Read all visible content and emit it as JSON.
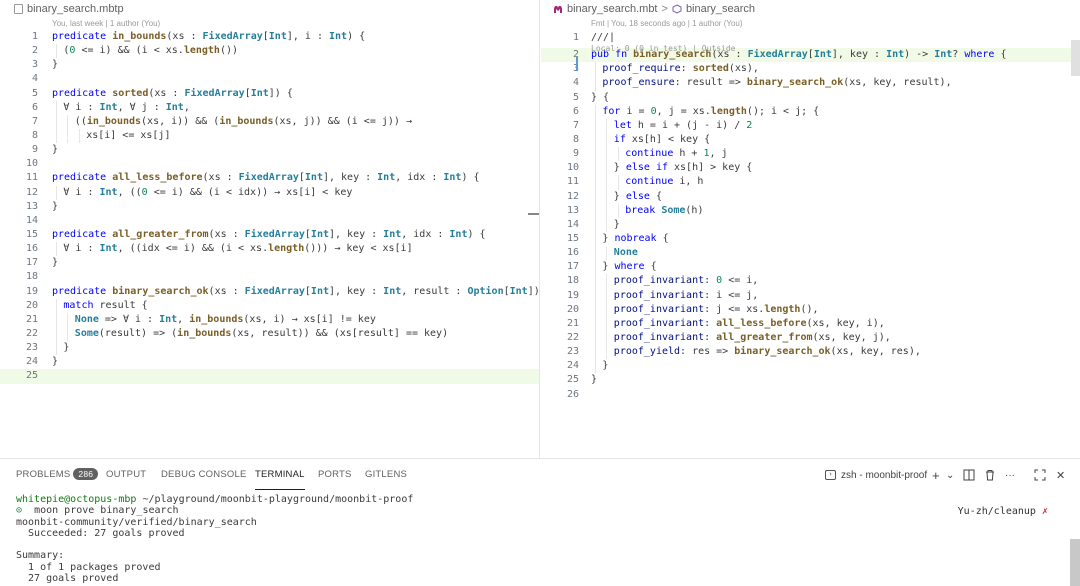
{
  "left_editor": {
    "breadcrumb": "binary_search.mbtp",
    "blame": "You, last week | 1 author (You)",
    "lines": [
      {
        "n": "1",
        "ind": 0,
        "segs": [
          [
            "kw",
            "predicate "
          ],
          [
            "fn",
            "in_bounds"
          ],
          [
            "t",
            "(xs : "
          ],
          [
            "ty",
            "FixedArray"
          ],
          [
            "t",
            "["
          ],
          [
            "ty",
            "Int"
          ],
          [
            "t",
            "], i : "
          ],
          [
            "ty",
            "Int"
          ],
          [
            "t",
            ") {"
          ]
        ]
      },
      {
        "n": "2",
        "ind": 1,
        "segs": [
          [
            "t",
            "("
          ],
          [
            "num",
            "0"
          ],
          [
            "t",
            " <= i) && (i < xs."
          ],
          [
            "fn",
            "length"
          ],
          [
            "t",
            "())"
          ]
        ]
      },
      {
        "n": "3",
        "ind": 0,
        "segs": [
          [
            "t",
            "}"
          ]
        ]
      },
      {
        "n": "4",
        "ind": 0,
        "segs": []
      },
      {
        "n": "5",
        "ind": 0,
        "segs": [
          [
            "kw",
            "predicate "
          ],
          [
            "fn",
            "sorted"
          ],
          [
            "t",
            "(xs : "
          ],
          [
            "ty",
            "FixedArray"
          ],
          [
            "t",
            "["
          ],
          [
            "ty",
            "Int"
          ],
          [
            "t",
            "]) {"
          ]
        ]
      },
      {
        "n": "6",
        "ind": 1,
        "segs": [
          [
            "t",
            "∀ i : "
          ],
          [
            "ty",
            "Int"
          ],
          [
            "t",
            ", ∀ j : "
          ],
          [
            "ty",
            "Int"
          ],
          [
            "t",
            ","
          ]
        ]
      },
      {
        "n": "7",
        "ind": 2,
        "segs": [
          [
            "t",
            "(("
          ],
          [
            "fn",
            "in_bounds"
          ],
          [
            "t",
            "(xs, i)) && ("
          ],
          [
            "fn",
            "in_bounds"
          ],
          [
            "t",
            "(xs, j)) && (i <= j)) →"
          ]
        ]
      },
      {
        "n": "8",
        "ind": 3,
        "segs": [
          [
            "t",
            "xs[i] <= xs[j]"
          ]
        ]
      },
      {
        "n": "9",
        "ind": 0,
        "segs": [
          [
            "t",
            "}"
          ]
        ]
      },
      {
        "n": "10",
        "ind": 0,
        "segs": []
      },
      {
        "n": "11",
        "ind": 0,
        "segs": [
          [
            "kw",
            "predicate "
          ],
          [
            "fn",
            "all_less_before"
          ],
          [
            "t",
            "(xs : "
          ],
          [
            "ty",
            "FixedArray"
          ],
          [
            "t",
            "["
          ],
          [
            "ty",
            "Int"
          ],
          [
            "t",
            "], key : "
          ],
          [
            "ty",
            "Int"
          ],
          [
            "t",
            ", idx : "
          ],
          [
            "ty",
            "Int"
          ],
          [
            "t",
            ") {"
          ]
        ]
      },
      {
        "n": "12",
        "ind": 1,
        "segs": [
          [
            "t",
            "∀ i : "
          ],
          [
            "ty",
            "Int"
          ],
          [
            "t",
            ", (("
          ],
          [
            "num",
            "0"
          ],
          [
            "t",
            " <= i) && (i < idx)) → xs[i] < key"
          ]
        ]
      },
      {
        "n": "13",
        "ind": 0,
        "segs": [
          [
            "t",
            "}"
          ]
        ]
      },
      {
        "n": "14",
        "ind": 0,
        "segs": []
      },
      {
        "n": "15",
        "ind": 0,
        "segs": [
          [
            "kw",
            "predicate "
          ],
          [
            "fn",
            "all_greater_from"
          ],
          [
            "t",
            "(xs : "
          ],
          [
            "ty",
            "FixedArray"
          ],
          [
            "t",
            "["
          ],
          [
            "ty",
            "Int"
          ],
          [
            "t",
            "], key : "
          ],
          [
            "ty",
            "Int"
          ],
          [
            "t",
            ", idx : "
          ],
          [
            "ty",
            "Int"
          ],
          [
            "t",
            ") {"
          ]
        ]
      },
      {
        "n": "16",
        "ind": 1,
        "segs": [
          [
            "t",
            "∀ i : "
          ],
          [
            "ty",
            "Int"
          ],
          [
            "t",
            ", ((idx <= i) && (i < xs."
          ],
          [
            "fn",
            "length"
          ],
          [
            "t",
            "())) → key < xs[i]"
          ]
        ]
      },
      {
        "n": "17",
        "ind": 0,
        "segs": [
          [
            "t",
            "}"
          ]
        ]
      },
      {
        "n": "18",
        "ind": 0,
        "segs": []
      },
      {
        "n": "19",
        "ind": 0,
        "segs": [
          [
            "kw",
            "predicate "
          ],
          [
            "fn",
            "binary_search_ok"
          ],
          [
            "t",
            "(xs : "
          ],
          [
            "ty",
            "FixedArray"
          ],
          [
            "t",
            "["
          ],
          [
            "ty",
            "Int"
          ],
          [
            "t",
            "], key : "
          ],
          [
            "ty",
            "Int"
          ],
          [
            "t",
            ", result : "
          ],
          [
            "ty",
            "Option"
          ],
          [
            "t",
            "["
          ],
          [
            "ty",
            "Int"
          ],
          [
            "t",
            "]) {"
          ]
        ]
      },
      {
        "n": "20",
        "ind": 1,
        "segs": [
          [
            "kw",
            "match "
          ],
          [
            "t",
            "result {"
          ]
        ]
      },
      {
        "n": "21",
        "ind": 2,
        "segs": [
          [
            "ty",
            "None"
          ],
          [
            "t",
            " => ∀ i : "
          ],
          [
            "ty",
            "Int"
          ],
          [
            "t",
            ", "
          ],
          [
            "fn",
            "in_bounds"
          ],
          [
            "t",
            "(xs, i) → xs[i] != key"
          ]
        ]
      },
      {
        "n": "22",
        "ind": 2,
        "segs": [
          [
            "ty",
            "Some"
          ],
          [
            "t",
            "(result) => ("
          ],
          [
            "fn",
            "in_bounds"
          ],
          [
            "t",
            "(xs, result)) && (xs[result] == key)"
          ]
        ]
      },
      {
        "n": "23",
        "ind": 1,
        "segs": [
          [
            "t",
            "}"
          ]
        ]
      },
      {
        "n": "24",
        "ind": 0,
        "segs": [
          [
            "t",
            "}"
          ]
        ]
      },
      {
        "n": "25",
        "ind": 0,
        "segs": [],
        "hl": true
      }
    ]
  },
  "right_editor": {
    "breadcrumb_file": "binary_search.mbt",
    "breadcrumb_sep": ">",
    "breadcrumb_symbol": "binary_search",
    "codelens": "Fmt | You, 18 seconds ago | 1 author (You)",
    "blame_inline": "Local: 0 (0 in test) | Outside",
    "lines": [
      {
        "n": "1",
        "ind": 0,
        "segs": [
          [
            "t",
            "///|"
          ]
        ]
      },
      {
        "n": "2",
        "ind": 0,
        "segs": [
          [
            "kw",
            "pub fn "
          ],
          [
            "fn",
            "binary_search"
          ],
          [
            "t",
            "(xs : "
          ],
          [
            "ty",
            "FixedArray"
          ],
          [
            "t",
            "["
          ],
          [
            "ty",
            "Int"
          ],
          [
            "t",
            "], key : "
          ],
          [
            "ty",
            "Int"
          ],
          [
            "t",
            ") -> "
          ],
          [
            "ty",
            "Int"
          ],
          [
            "t",
            "? "
          ],
          [
            "kw",
            "where"
          ],
          [
            "t",
            " {"
          ]
        ],
        "hl": true
      },
      {
        "n": "3",
        "ind": 1,
        "segs": [
          [
            "pr",
            "proof_require"
          ],
          [
            "t",
            ": "
          ],
          [
            "fn",
            "sorted"
          ],
          [
            "t",
            "(xs),"
          ]
        ]
      },
      {
        "n": "4",
        "ind": 1,
        "segs": [
          [
            "pr",
            "proof_ensure"
          ],
          [
            "t",
            ": result => "
          ],
          [
            "fn",
            "binary_search_ok"
          ],
          [
            "t",
            "(xs, key, result),"
          ]
        ]
      },
      {
        "n": "5",
        "ind": 0,
        "segs": [
          [
            "t",
            "} {"
          ]
        ]
      },
      {
        "n": "6",
        "ind": 1,
        "segs": [
          [
            "kw",
            "for "
          ],
          [
            "t",
            "i = "
          ],
          [
            "num",
            "0"
          ],
          [
            "t",
            ", j = xs."
          ],
          [
            "fn",
            "length"
          ],
          [
            "t",
            "(); i < j; {"
          ]
        ]
      },
      {
        "n": "7",
        "ind": 2,
        "segs": [
          [
            "kw",
            "let "
          ],
          [
            "t",
            "h = i + (j - i) / "
          ],
          [
            "num",
            "2"
          ]
        ]
      },
      {
        "n": "8",
        "ind": 2,
        "segs": [
          [
            "kw",
            "if "
          ],
          [
            "t",
            "xs[h] < key {"
          ]
        ]
      },
      {
        "n": "9",
        "ind": 3,
        "segs": [
          [
            "kw",
            "continue "
          ],
          [
            "t",
            "h + "
          ],
          [
            "num",
            "1"
          ],
          [
            "t",
            ", j"
          ]
        ]
      },
      {
        "n": "10",
        "ind": 2,
        "segs": [
          [
            "t",
            "} "
          ],
          [
            "kw",
            "else if "
          ],
          [
            "t",
            "xs[h] > key {"
          ]
        ]
      },
      {
        "n": "11",
        "ind": 3,
        "segs": [
          [
            "kw",
            "continue "
          ],
          [
            "t",
            "i, h"
          ]
        ]
      },
      {
        "n": "12",
        "ind": 2,
        "segs": [
          [
            "t",
            "} "
          ],
          [
            "kw",
            "else"
          ],
          [
            "t",
            " {"
          ]
        ]
      },
      {
        "n": "13",
        "ind": 3,
        "segs": [
          [
            "kw",
            "break "
          ],
          [
            "ty",
            "Some"
          ],
          [
            "t",
            "(h)"
          ]
        ]
      },
      {
        "n": "14",
        "ind": 2,
        "segs": [
          [
            "t",
            "}"
          ]
        ]
      },
      {
        "n": "15",
        "ind": 1,
        "segs": [
          [
            "t",
            "} "
          ],
          [
            "kw",
            "nobreak"
          ],
          [
            "t",
            " {"
          ]
        ]
      },
      {
        "n": "16",
        "ind": 2,
        "segs": [
          [
            "ty",
            "None"
          ]
        ]
      },
      {
        "n": "17",
        "ind": 1,
        "segs": [
          [
            "t",
            "} "
          ],
          [
            "kw",
            "where"
          ],
          [
            "t",
            " {"
          ]
        ]
      },
      {
        "n": "18",
        "ind": 2,
        "segs": [
          [
            "pr",
            "proof_invariant"
          ],
          [
            "t",
            ": "
          ],
          [
            "num",
            "0"
          ],
          [
            "t",
            " <= i,"
          ]
        ]
      },
      {
        "n": "19",
        "ind": 2,
        "segs": [
          [
            "pr",
            "proof_invariant"
          ],
          [
            "t",
            ": i <= j,"
          ]
        ]
      },
      {
        "n": "20",
        "ind": 2,
        "segs": [
          [
            "pr",
            "proof_invariant"
          ],
          [
            "t",
            ": j <= xs."
          ],
          [
            "fn",
            "length"
          ],
          [
            "t",
            "(),"
          ]
        ]
      },
      {
        "n": "21",
        "ind": 2,
        "segs": [
          [
            "pr",
            "proof_invariant"
          ],
          [
            "t",
            ": "
          ],
          [
            "fn",
            "all_less_before"
          ],
          [
            "t",
            "(xs, key, i),"
          ]
        ]
      },
      {
        "n": "22",
        "ind": 2,
        "segs": [
          [
            "pr",
            "proof_invariant"
          ],
          [
            "t",
            ": "
          ],
          [
            "fn",
            "all_greater_from"
          ],
          [
            "t",
            "(xs, key, j),"
          ]
        ]
      },
      {
        "n": "23",
        "ind": 2,
        "segs": [
          [
            "pr",
            "proof_yield"
          ],
          [
            "t",
            ": res => "
          ],
          [
            "fn",
            "binary_search_ok"
          ],
          [
            "t",
            "(xs, key, res),"
          ]
        ]
      },
      {
        "n": "24",
        "ind": 1,
        "segs": [
          [
            "t",
            "}"
          ]
        ]
      },
      {
        "n": "25",
        "ind": 0,
        "segs": [
          [
            "t",
            "}"
          ]
        ]
      },
      {
        "n": "26",
        "ind": 0,
        "segs": []
      }
    ]
  },
  "panel": {
    "tabs": {
      "problems": "PROBLEMS",
      "problems_count": "286",
      "output": "OUTPUT",
      "debug_console": "DEBUG CONSOLE",
      "terminal": "TERMINAL",
      "ports": "PORTS",
      "gitlens": "GITLENS"
    },
    "terminal_name": "zsh - moonbit-proof",
    "add_symbol": "+",
    "chevron_symbol": "⌄",
    "more_symbol": "···",
    "close_symbol": "✕",
    "terminal": {
      "prompt_user": "whitepie@octopus-mbp",
      "prompt_path": " ~/playground/moonbit-playground/moonbit-proof",
      "command_marker": "⊙",
      "command": "  moon prove binary_search",
      "lines": [
        "moonbit-community/verified/binary_search",
        "  Succeeded: 27 goals proved",
        "",
        "Summary:",
        "  1 of 1 packages proved",
        "  27 goals proved"
      ]
    },
    "branch": "Yu-zh/cleanup",
    "branch_mark": "✗"
  }
}
